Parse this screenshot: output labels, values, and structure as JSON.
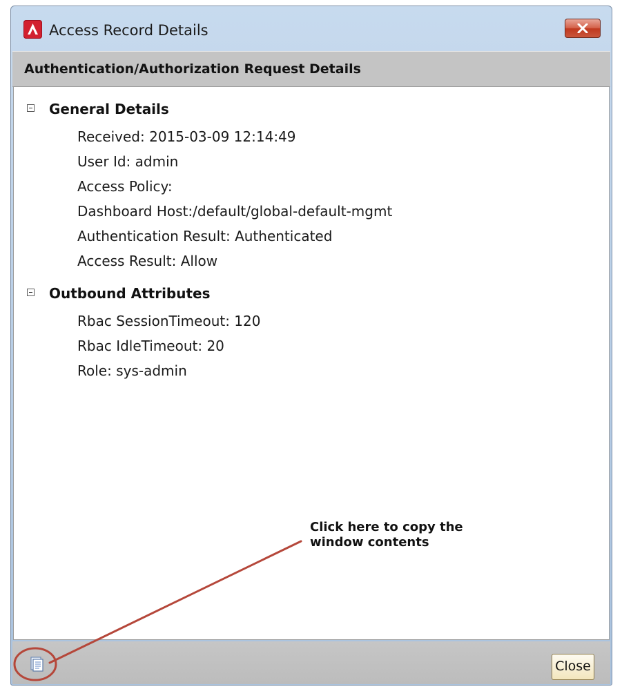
{
  "window": {
    "title": "Access Record Details",
    "header": "Authentication/Authorization Request Details"
  },
  "sections": [
    {
      "title": "General Details",
      "items": [
        "Received:  2015-03-09 12:14:49",
        "User Id: admin",
        "Access Policy:",
        "Dashboard Host:/default/global-default-mgmt",
        "Authentication Result: Authenticated",
        "Access Result: Allow"
      ]
    },
    {
      "title": "Outbound Attributes",
      "items": [
        "Rbac SessionTimeout: 120",
        "Rbac IdleTimeout: 20",
        "Role: sys-admin"
      ]
    }
  ],
  "annotation": {
    "line1": "Click here to copy the",
    "line2": "window contents",
    "color": "#b5473a"
  },
  "footer": {
    "close_label": "Close"
  },
  "icons": {
    "app": "app-logo-icon",
    "close": "close-icon",
    "copy": "copy-icon"
  }
}
